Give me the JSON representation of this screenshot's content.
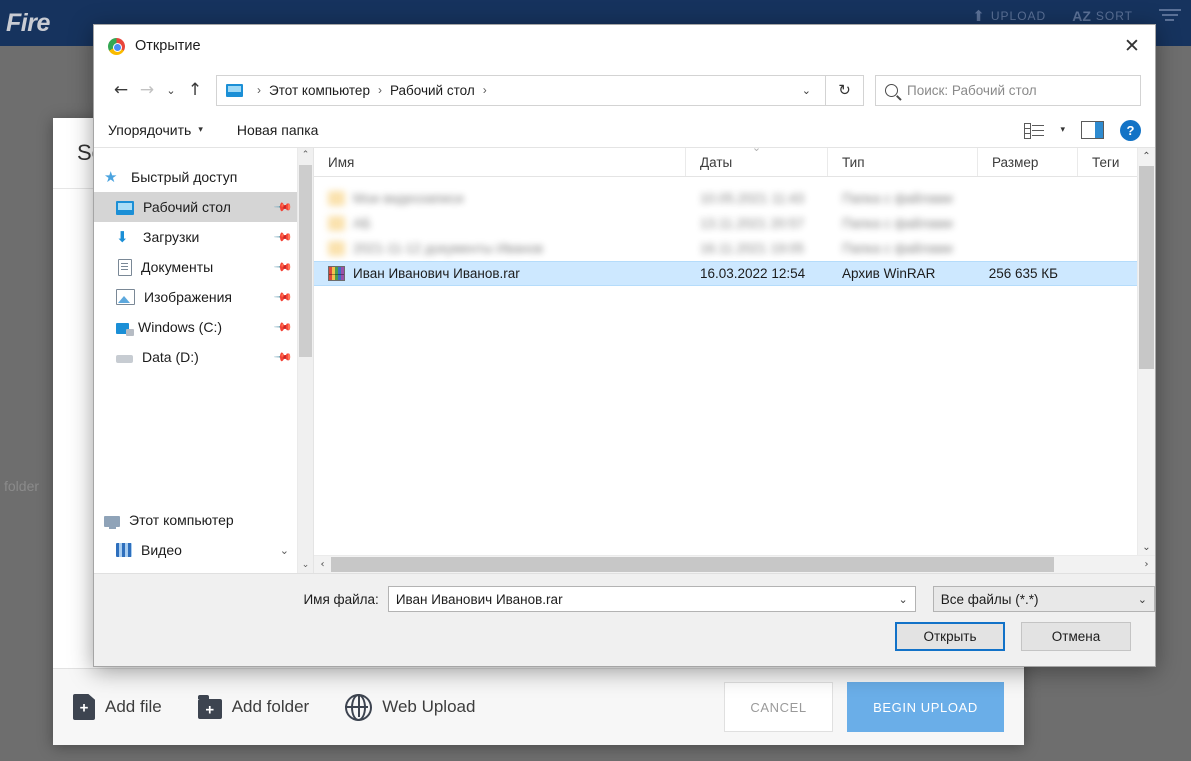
{
  "background": {
    "logo": "Fire",
    "nav": [
      {
        "label": "UPLOAD",
        "icon": "upload-arrow-icon"
      },
      {
        "label": "SORT",
        "icon": "az-sort-icon",
        "prefix": "AZ"
      }
    ],
    "filter_icon": "filter-lines-icon",
    "folder_text": "folder",
    "modal": {
      "title": "Se",
      "footer": {
        "add_file": "Add file",
        "add_folder": "Add folder",
        "web_upload": "Web Upload",
        "cancel": "CANCEL",
        "begin_upload": "BEGIN UPLOAD"
      }
    }
  },
  "dialog": {
    "title": "Открытие",
    "app_icon": "chrome-icon",
    "close": "✕",
    "nav": {
      "back": "←",
      "forward": "→",
      "recent": "⌄",
      "up": "↑",
      "breadcrumb": [
        "Этот компьютер",
        "Рабочий стол"
      ],
      "breadcrumb_sep": "›",
      "address_caret": "⌄",
      "refresh": "↻",
      "search_placeholder": "Поиск: Рабочий стол"
    },
    "toolbar": {
      "organize": "Упорядочить",
      "organize_caret": "▾",
      "new_folder": "Новая папка",
      "view_caret": "▾"
    },
    "navpane": {
      "items": [
        {
          "label": "Быстрый доступ",
          "icon": "star-icon",
          "pinned": false,
          "selected": false,
          "root": true
        },
        {
          "label": "Рабочий стол",
          "icon": "desktop-icon",
          "pinned": true,
          "selected": true,
          "root": false
        },
        {
          "label": "Загрузки",
          "icon": "downloads-icon",
          "pinned": true,
          "selected": false,
          "root": false
        },
        {
          "label": "Документы",
          "icon": "documents-icon",
          "pinned": true,
          "selected": false,
          "root": false
        },
        {
          "label": "Изображения",
          "icon": "pictures-icon",
          "pinned": true,
          "selected": false,
          "root": false
        },
        {
          "label": "Windows (C:)",
          "icon": "windows-drive-icon",
          "pinned": true,
          "selected": false,
          "root": false
        },
        {
          "label": "Data (D:)",
          "icon": "hard-drive-icon",
          "pinned": true,
          "selected": false,
          "root": false
        }
      ],
      "bottom_items": [
        {
          "label": "Этот компьютер",
          "icon": "this-pc-icon",
          "caret": false
        },
        {
          "label": "Видео",
          "icon": "videos-icon",
          "caret": true
        }
      ]
    },
    "columns": [
      {
        "key": "name",
        "label": "Имя",
        "sorted": false
      },
      {
        "key": "date",
        "label": "Даты",
        "sorted": true
      },
      {
        "key": "type",
        "label": "Тип",
        "sorted": false
      },
      {
        "key": "size",
        "label": "Размер",
        "sorted": false
      },
      {
        "key": "tags",
        "label": "Теги",
        "sorted": false
      }
    ],
    "rows": [
      {
        "name": "Мои видеозаписи",
        "date": "10.05.2021 11:43",
        "type": "Папка с файлами",
        "size": "",
        "icon": "folder-icon",
        "blurred": true,
        "selected": false
      },
      {
        "name": "АБ",
        "date": "13.11.2021 20:57",
        "type": "Папка с файлами",
        "size": "",
        "icon": "folder-icon",
        "blurred": true,
        "selected": false
      },
      {
        "name": "2021-11-12 документы Иванов",
        "date": "16.11.2021 19:05",
        "type": "Папка с файлами",
        "size": "",
        "icon": "folder-icon",
        "blurred": true,
        "selected": false
      },
      {
        "name": "Иван Иванович Иванов.rar",
        "date": "16.03.2022 12:54",
        "type": "Архив WinRAR",
        "size": "256 635 КБ",
        "icon": "winrar-icon",
        "blurred": false,
        "selected": true
      }
    ],
    "bottom": {
      "filename_label": "Имя файла:",
      "filename_value": "Иван Иванович Иванов.rar",
      "filetype_value": "Все файлы (*.*)",
      "open_button": "Открыть",
      "cancel_button": "Отмена",
      "caret": "⌄"
    }
  }
}
